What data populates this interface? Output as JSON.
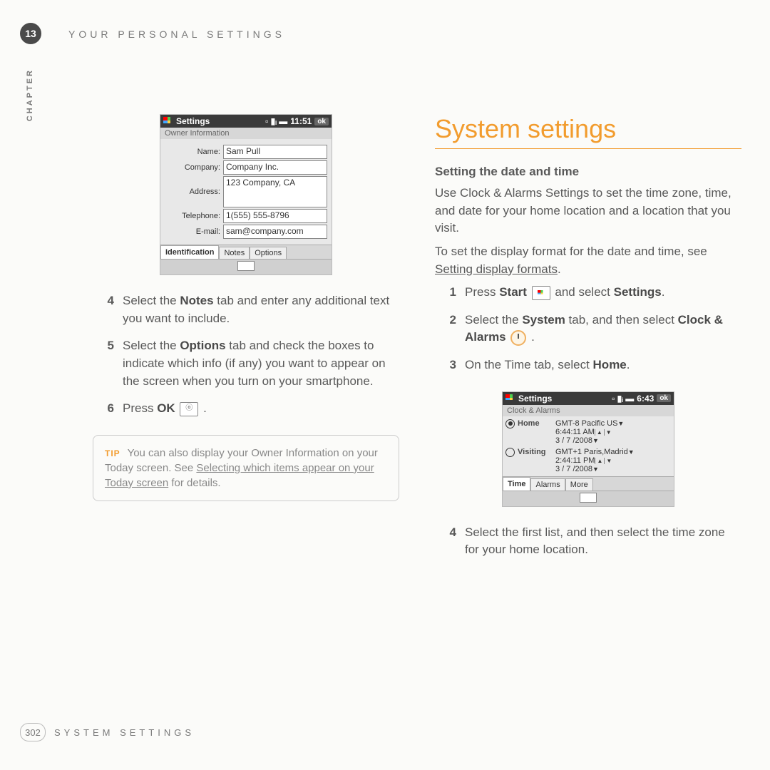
{
  "header": {
    "chapter_num": "13",
    "chapter_title": "YOUR PERSONAL SETTINGS",
    "chapter_side": "CHAPTER"
  },
  "footer": {
    "page": "302",
    "title": "SYSTEM SETTINGS"
  },
  "left": {
    "screenshot": {
      "title": "Settings",
      "time": "11:51",
      "ok": "ok",
      "subtitle": "Owner Information",
      "fields": {
        "name_label": "Name:",
        "name": "Sam Pull",
        "company_label": "Company:",
        "company": "Company Inc.",
        "address_label": "Address:",
        "address": "123 Company, CA",
        "telephone_label": "Telephone:",
        "telephone": "1(555) 555-8796",
        "email_label": "E-mail:",
        "email": "sam@company.com"
      },
      "tabs": [
        "Identification",
        "Notes",
        "Options"
      ]
    },
    "steps": {
      "s4": {
        "n": "4",
        "pre": "Select the ",
        "bold": "Notes",
        "post": " tab and enter any additional text you want to include."
      },
      "s5": {
        "n": "5",
        "pre": "Select the ",
        "bold": "Options",
        "post": " tab and check the boxes to indicate which info (if any) you want to appear on the screen when you turn on your smartphone."
      },
      "s6": {
        "n": "6",
        "pre": "Press ",
        "bold": "OK",
        "post": " ."
      }
    },
    "tip": {
      "label": "TIP",
      "pre": " You can also display your Owner Information on your Today screen. See ",
      "link": "Selecting which items appear on your Today screen",
      "post": " for details."
    }
  },
  "right": {
    "h1": "System settings",
    "h3": "Setting the date and time",
    "p1": "Use Clock & Alarms Settings to set the time zone, time, and date for your home location and a location that you visit.",
    "p2_pre": "To set the display format for the date and time, see ",
    "p2_link": "Setting display formats",
    "p2_post": ".",
    "steps": {
      "s1": {
        "n": "1",
        "pre": "Press ",
        "b1": "Start",
        "mid": " and select ",
        "b2": "Settings",
        "post": "."
      },
      "s2": {
        "n": "2",
        "pre": "Select the ",
        "b1": "System",
        "mid": " tab, and then select ",
        "b2": "Clock & Alarms",
        "post": " ."
      },
      "s3": {
        "n": "3",
        "pre": "On the Time tab, select ",
        "b1": "Home",
        "post": "."
      },
      "s4": {
        "n": "4",
        "text": "Select the first list, and then select the time zone for your home location."
      }
    },
    "screenshot": {
      "title": "Settings",
      "time": "6:43",
      "ok": "ok",
      "subtitle": "Clock & Alarms",
      "home": "Home",
      "visiting": "Visiting",
      "tz_home": "GMT-8 Pacific US",
      "time_home": "6:44:11 AM",
      "date_home": "3 / 7 /2008",
      "tz_visit": "GMT+1 Paris,Madrid",
      "time_visit": "2:44:11 PM",
      "date_visit": "3 / 7 /2008",
      "tabs": [
        "Time",
        "Alarms",
        "More"
      ]
    }
  }
}
